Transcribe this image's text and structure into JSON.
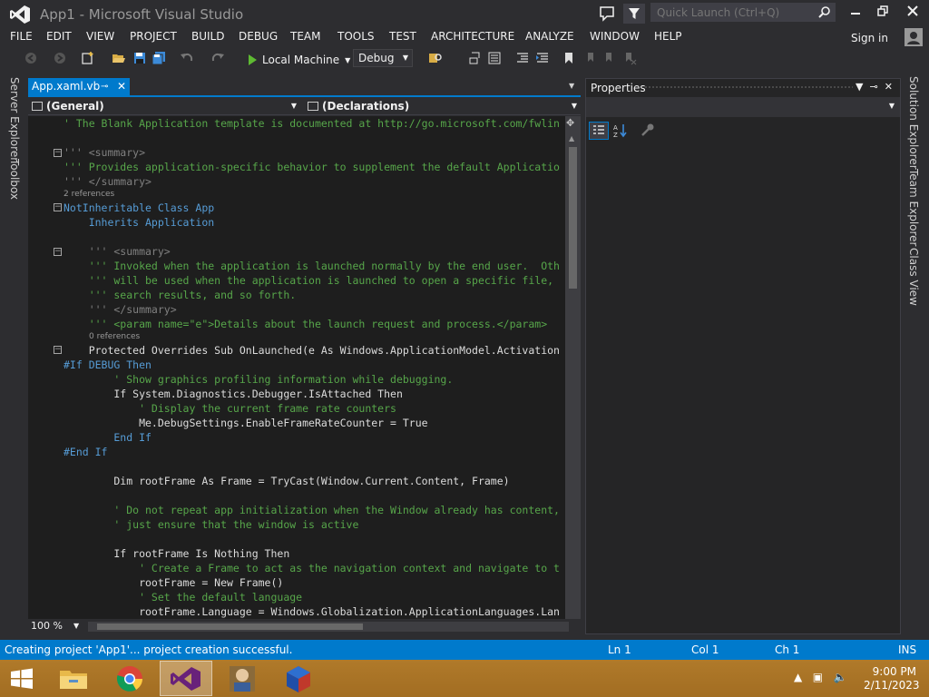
{
  "window": {
    "title": "App1 - Microsoft Visual Studio"
  },
  "quick_launch": {
    "placeholder": "Quick Launch (Ctrl+Q)"
  },
  "menu": [
    "FILE",
    "EDIT",
    "VIEW",
    "PROJECT",
    "BUILD",
    "DEBUG",
    "TEAM",
    "TOOLS",
    "TEST",
    "ARCHITECTURE",
    "ANALYZE",
    "WINDOW",
    "HELP"
  ],
  "account": {
    "sign_in": "Sign in"
  },
  "toolbar": {
    "run_target": "Local Machine",
    "configuration": "Debug"
  },
  "left_tabs": [
    "Server Explorer",
    "Toolbox"
  ],
  "right_tabs": [
    "Solution Explorer",
    "Team Explorer",
    "Class View"
  ],
  "editor": {
    "tab_label": "App.xaml.vb",
    "nav_left": "(General)",
    "nav_right": "(Declarations)",
    "zoom": "100 %",
    "references": [
      "2 references",
      "0 references"
    ],
    "lines": [
      "' The Blank Application template is documented at http://go.microsoft.com/fwlin",
      "''' <summary>",
      "''' Provides application-specific behavior to supplement the default Applicatio",
      "''' </summary>",
      "NotInheritable Class App",
      "    Inherits Application",
      "    ''' <summary>",
      "    ''' Invoked when the application is launched normally by the end user.  Oth",
      "    ''' will be used when the application is launched to open a specific file,",
      "    ''' search results, and so forth.",
      "    ''' </summary>",
      "    ''' <param name=\"e\">Details about the launch request and process.</param>",
      "    Protected Overrides Sub OnLaunched(e As Windows.ApplicationModel.Activation",
      "#If DEBUG Then",
      "        ' Show graphics profiling information while debugging.",
      "        If System.Diagnostics.Debugger.IsAttached Then",
      "            ' Display the current frame rate counters",
      "            Me.DebugSettings.EnableFrameRateCounter = True",
      "        End If",
      "#End If",
      "        Dim rootFrame As Frame = TryCast(Window.Current.Content, Frame)",
      "        ' Do not repeat app initialization when the Window already has content,",
      "        ' just ensure that the window is active",
      "        If rootFrame Is Nothing Then",
      "            ' Create a Frame to act as the navigation context and navigate to t",
      "            rootFrame = New Frame()",
      "            ' Set the default language",
      "            rootFrame.Language = Windows.Globalization.ApplicationLanguages.Lan"
    ]
  },
  "properties": {
    "title": "Properties"
  },
  "status": {
    "message": "Creating project 'App1'... project creation successful.",
    "line": "Ln 1",
    "col": "Col 1",
    "ch": "Ch 1",
    "mode": "INS"
  },
  "taskbar": {
    "time": "9:00 PM",
    "date": "2/11/2023"
  },
  "colors": {
    "accent": "#007acc",
    "editor_bg": "#1e1e1e",
    "comment": "#57a64a",
    "keyword": "#569cd6",
    "type": "#4ec9b0"
  }
}
